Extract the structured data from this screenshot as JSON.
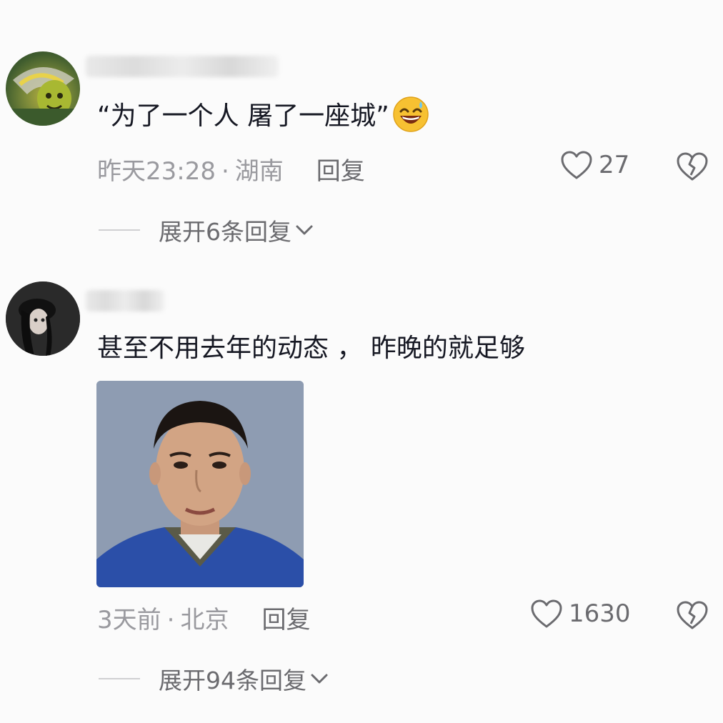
{
  "comments": [
    {
      "content": "“为了一个人 屠了一座城”",
      "emoji": "grinning-sweat-emoji",
      "time": "昨天23:28",
      "separator": "·",
      "location": "湖南",
      "reply_label": "回复",
      "likes": "27",
      "expand_label": "展开6条回复"
    },
    {
      "content": "甚至不用去年的动态 ， 昨晚的就足够",
      "time": "3天前",
      "separator": "·",
      "location": "北京",
      "reply_label": "回复",
      "likes": "1630",
      "expand_label": "展开94条回复"
    }
  ],
  "icons": {
    "like": "heart-outline-icon",
    "dislike": "broken-heart-icon",
    "expand": "chevron-down-icon"
  },
  "colors": {
    "background": "#fbfbfb",
    "text": "#161823",
    "meta_text": "#9a9a9f",
    "action_text": "#6b6b6f"
  }
}
